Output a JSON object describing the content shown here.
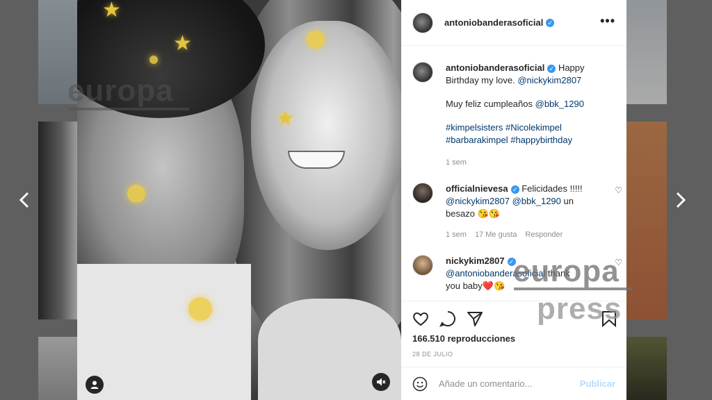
{
  "post": {
    "username": "antoniobanderasoficial",
    "more_label": "•••",
    "caption_user": "antoniobanderasoficial",
    "caption_line1": "Happy",
    "caption_line2": "Birthday my love.",
    "caption_mention": "@nickykim2807",
    "caption_es_prefix": "Muy feliz cumpleaños",
    "caption_es_mention": "@bbk_1290",
    "hashtags_line1": "#kimpelsisters #Nicolekimpel",
    "hashtags_line2": "#barbarakimpel #happybirthday",
    "caption_time": "1 sem",
    "views": "166.510 reproducciones",
    "date": "28 DE JULIO",
    "comment_placeholder": "Añade un comentario...",
    "publish_label": "Publicar"
  },
  "comments": [
    {
      "user": "officialnievesa",
      "text": "Felicidades !!!!!",
      "mention1": "@nickykim2807",
      "mention2": "@bbk_1290",
      "text2": "un",
      "text3": "besazo",
      "emoji": "😘😘",
      "time": "1 sem",
      "likes": "17 Me gusta",
      "reply": "Responder"
    },
    {
      "user": "nickykim2807",
      "mention": "@antoniobanderasoficial",
      "text": "thank",
      "text2": "you baby",
      "emoji": "❤️😘"
    }
  ],
  "watermark": {
    "brand_top": "europa",
    "brand_bottom": "press"
  },
  "colors": {
    "verified": "#3897f0",
    "link": "#00376b",
    "publish": "#b3dbff",
    "star": "#e3c53e"
  },
  "icons": [
    "chevron-left-icon",
    "chevron-right-icon",
    "heart-icon",
    "comment-icon",
    "share-icon",
    "bookmark-icon",
    "emoji-icon",
    "user-icon",
    "mute-icon",
    "verified-icon",
    "more-icon"
  ]
}
